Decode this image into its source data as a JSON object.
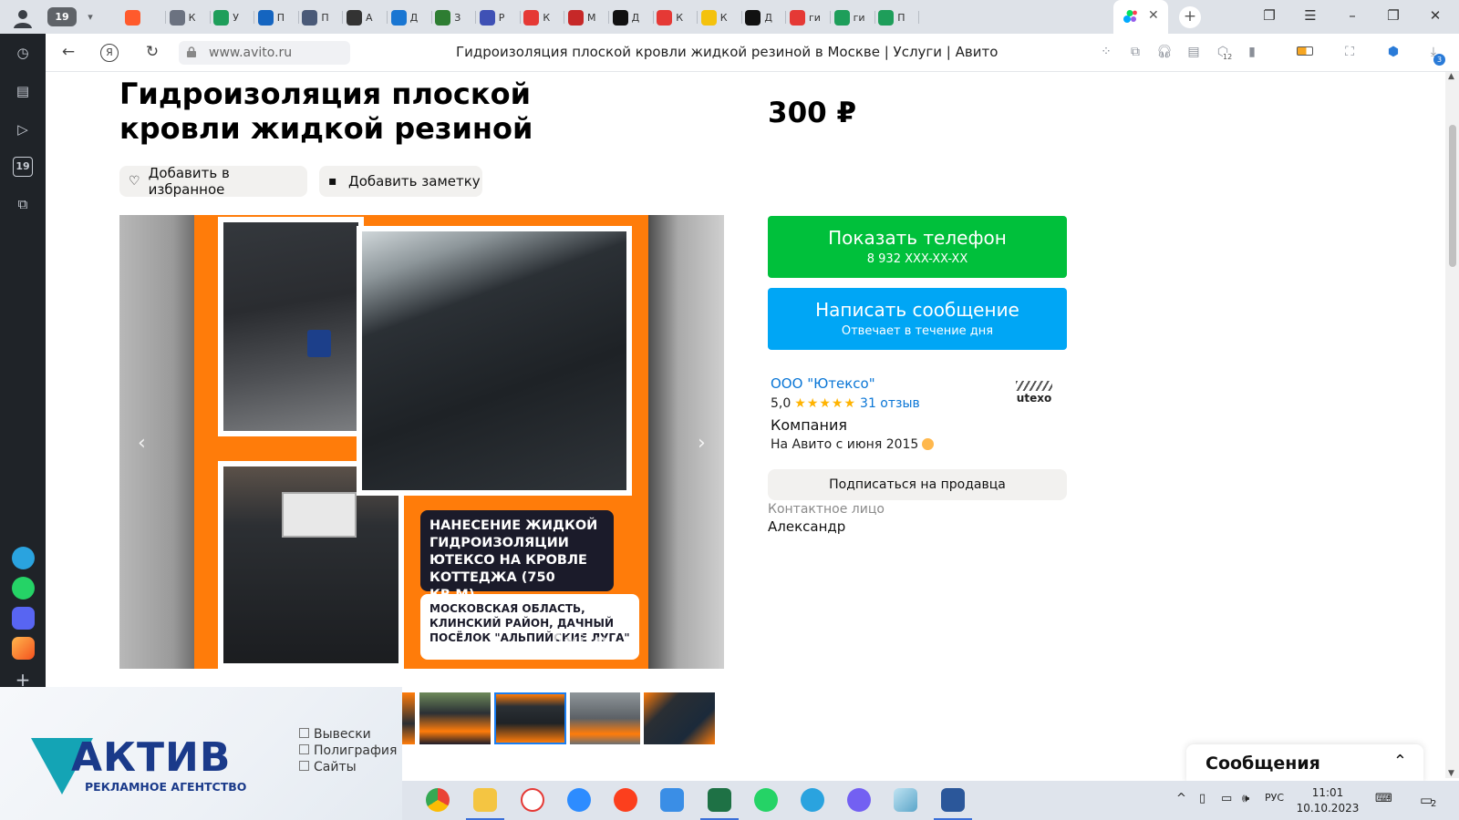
{
  "browser": {
    "tab_count": "19",
    "tabs": [
      {
        "label": "",
        "color": "#ff5a2c"
      },
      {
        "label": "К",
        "color": "#6b7280"
      },
      {
        "label": "У",
        "color": "#1e9e5a"
      },
      {
        "label": "П",
        "color": "#1565c0"
      },
      {
        "label": "П",
        "color": "#4a5a78"
      },
      {
        "label": "А",
        "color": "#333333"
      },
      {
        "label": "Д",
        "color": "#1976d2"
      },
      {
        "label": "З",
        "color": "#2e7d32"
      },
      {
        "label": "Р",
        "color": "#3f51b5"
      },
      {
        "label": "К",
        "color": "#e53935"
      },
      {
        "label": "М",
        "color": "#c62828"
      },
      {
        "label": "Д",
        "color": "#111111"
      },
      {
        "label": "К",
        "color": "#e53935"
      },
      {
        "label": "К",
        "color": "#f4c20d"
      },
      {
        "label": "Д",
        "color": "#111111"
      },
      {
        "label": "ги",
        "color": "#e53935"
      },
      {
        "label": "ги",
        "color": "#1e9e5a"
      },
      {
        "label": "П",
        "color": "#1e9e5a"
      }
    ],
    "url": "www.avito.ru",
    "page_title": "Гидроизоляция плоской кровли жидкой резиной в Москве | Услуги | Авито",
    "toolbar_badge": "12",
    "download_badge": "3"
  },
  "sidebar": {
    "calendar_day": "19"
  },
  "listing": {
    "title": "Гидроизоляция плоской кровли жидкой резиной",
    "price": "300 ₽",
    "add_favorite": "Добавить в избранное",
    "add_note": "Добавить заметку"
  },
  "gallery": {
    "headline": "НАНЕСЕНИЕ ЖИДКОЙ ГИДРОИЗОЛЯЦИИ ЮТЕКСО НА КРОВЛЕ КОТТЕДЖА (750 КВ.М)",
    "location_text": "МОСКОВСКАЯ ОБЛАСТЬ, КЛИНСКИЙ РАЙОН, ДАЧНЫЙ ПОСЁЛОК \"АЛЬПИЙСКИЕ ЛУГА\"",
    "watermark": "Avito",
    "accent_color": "#ff7c0a"
  },
  "contact": {
    "phone_button": "Показать телефон",
    "phone_masked": "8 932 XXX-XX-XX",
    "message_button": "Написать сообщение",
    "message_sub": "Отвечает в течение дня",
    "phone_color": "#00c03b",
    "message_color": "#00a6f5"
  },
  "seller": {
    "name": "ООО \"Ютексо\"",
    "rating": "5,0",
    "stars": "★★★★★",
    "reviews": "31 отзыв",
    "type": "Компания",
    "since": "На Авито с июня 2015",
    "logo_text": "utexo",
    "subscribe": "Подписаться на продавца",
    "contact_label": "Контактное лицо",
    "contact_name": "Александр"
  },
  "banner": {
    "brand": "АКТИВ",
    "tagline": "РЕКЛАМНОЕ АГЕНТСТВО",
    "services": [
      "Вывески",
      "Полиграфия",
      "Сайты"
    ]
  },
  "messages_panel": {
    "label": "Сообщения"
  },
  "taskbar": {
    "language": "РУС",
    "time": "11:01",
    "date": "10.10.2023",
    "notifications": "2"
  }
}
